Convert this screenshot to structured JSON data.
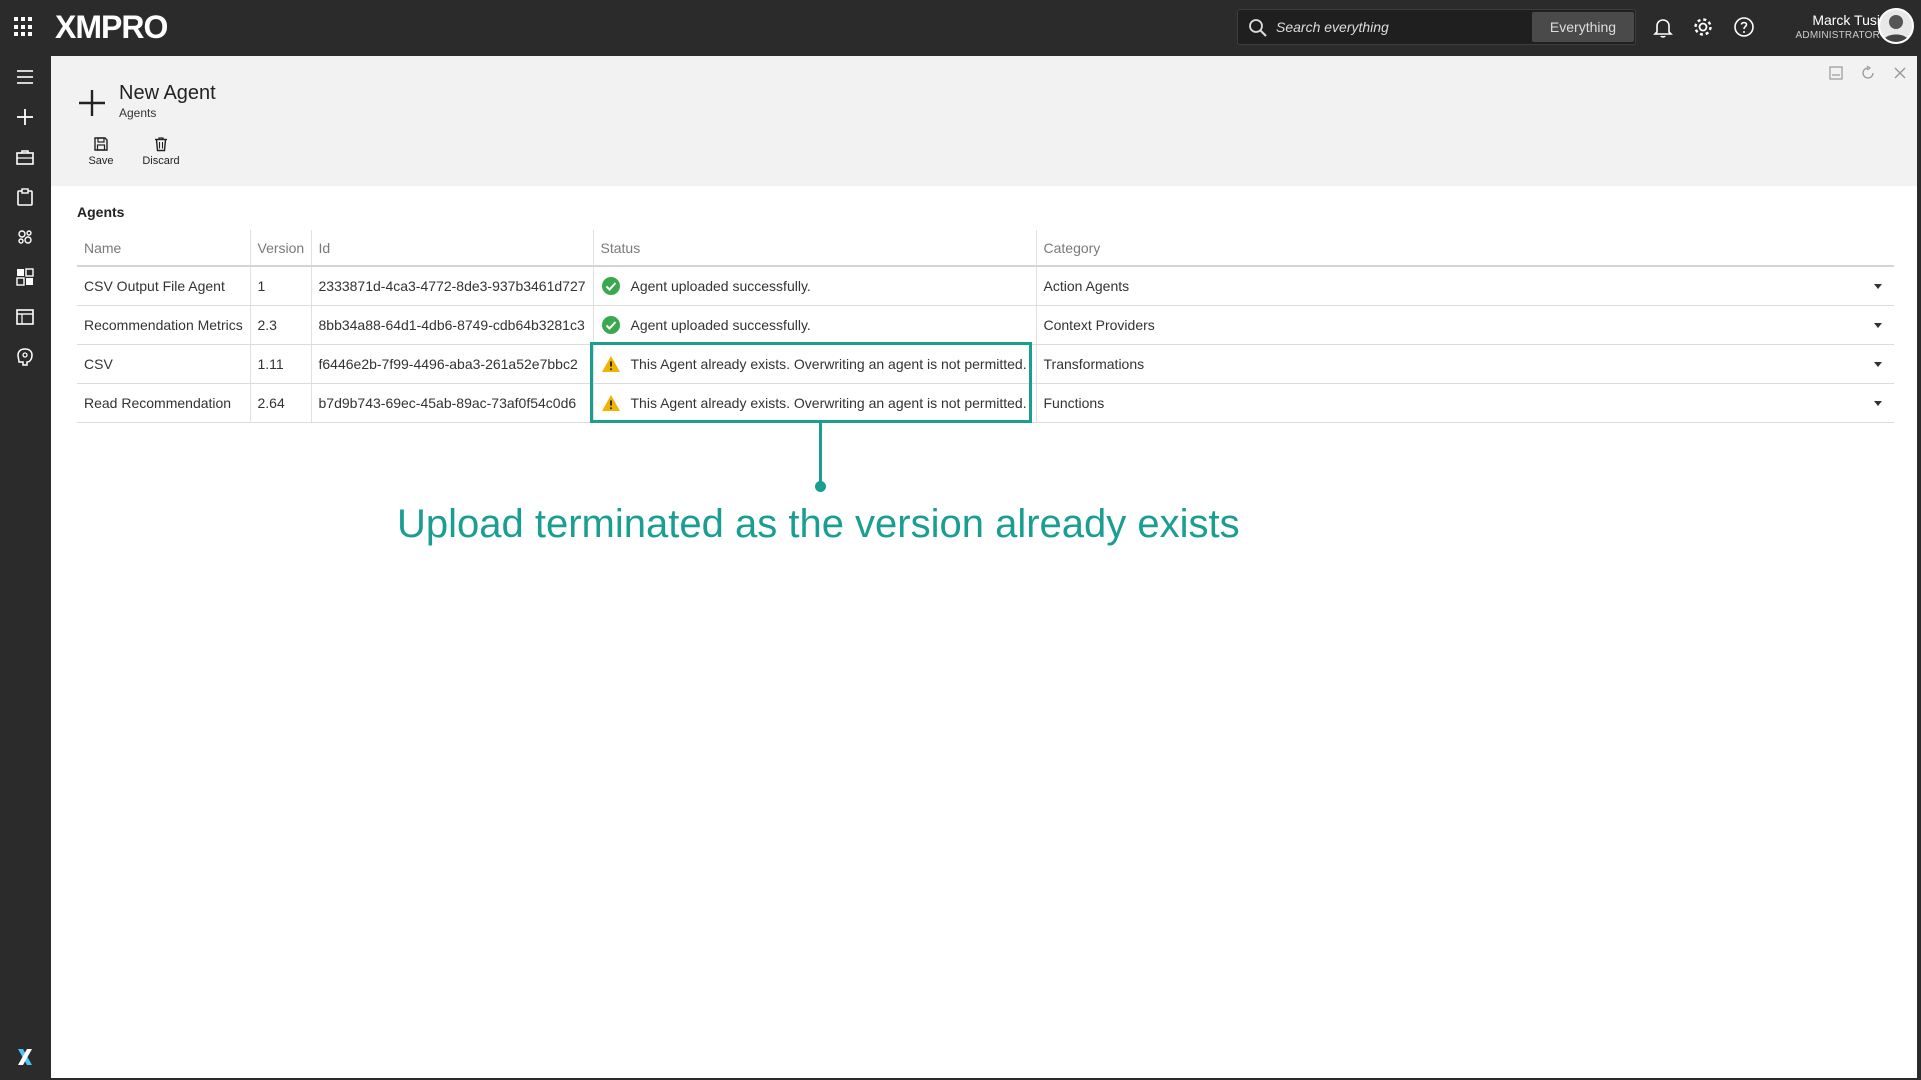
{
  "topbar": {
    "logo": "XMPRO",
    "search_placeholder": "Search everything",
    "search_scope": "Everything",
    "user_name": "Marck Tusi",
    "user_role": "ADMINISTRATOR"
  },
  "sidebar": {
    "items": [
      "menu-icon",
      "add-icon",
      "briefcase-icon",
      "clipboard-icon",
      "agents-icon",
      "dashboard-icon",
      "calendar-icon",
      "brain-icon"
    ]
  },
  "page": {
    "title": "New Agent",
    "subtitle": "Agents",
    "toolbar": {
      "save_label": "Save",
      "discard_label": "Discard"
    }
  },
  "section": {
    "label": "Agents"
  },
  "table": {
    "columns": [
      "Name",
      "Version",
      "Id",
      "Status",
      "Category"
    ],
    "rows": [
      {
        "name": "CSV Output File Agent",
        "version": "1",
        "id": "2333871d-4ca3-4772-8de3-937b3461d727",
        "status": "Agent uploaded successfully.",
        "status_type": "success",
        "category": "Action Agents"
      },
      {
        "name": "Recommendation Metrics",
        "version": "2.3",
        "id": "8bb34a88-64d1-4db6-8749-cdb64b3281c3",
        "status": "Agent uploaded successfully.",
        "status_type": "success",
        "category": "Context Providers"
      },
      {
        "name": "CSV",
        "version": "1.11",
        "id": "f6446e2b-7f99-4496-aba3-261a52e7bbc2",
        "status": "This Agent already exists. Overwriting an agent is not permitted.",
        "status_type": "warning",
        "category": "Transformations"
      },
      {
        "name": "Read Recommendation",
        "version": "2.64",
        "id": "b7d9b743-69ec-45ab-89ac-73af0f54c0d6",
        "status": "This Agent already exists. Overwriting an agent is not permitted.",
        "status_type": "warning",
        "category": "Functions"
      }
    ]
  },
  "annotation": {
    "text": "Upload terminated as the version already exists",
    "color": "#1a9e92"
  },
  "colors": {
    "success": "#3aa94e",
    "warning": "#f0b400",
    "chrome": "#2b2b2b"
  }
}
